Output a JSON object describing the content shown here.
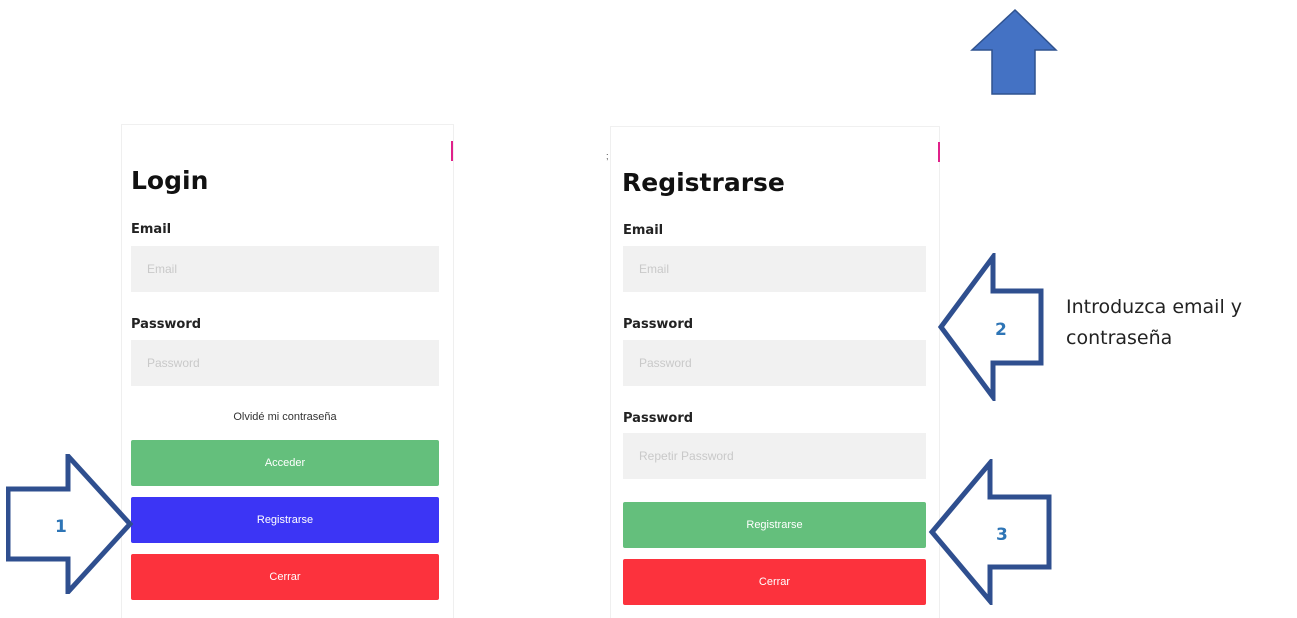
{
  "login": {
    "title": "Login",
    "email_label": "Email",
    "email_placeholder": "Email",
    "password_label": "Password",
    "password_placeholder": "Password",
    "forgot_link": "Olvidé mi contraseña",
    "access_button": "Acceder",
    "register_button": "Registrarse",
    "close_button": "Cerrar"
  },
  "register": {
    "title": "Registrarse",
    "email_label": "Email",
    "email_placeholder": "Email",
    "password_label": "Password",
    "password_placeholder": "Password",
    "repeat_label": "Password",
    "repeat_placeholder": "Repetir Password",
    "register_button": "Registrarse",
    "close_button": "Cerrar"
  },
  "annotations": {
    "arrow1_number": "1",
    "arrow2_number": "2",
    "arrow3_number": "3",
    "note_line1": "Introduzca email y",
    "note_line2": "contraseña"
  },
  "colors": {
    "access_button": "#64bf7c",
    "login_register_button": "#3c35f5",
    "close_button": "#fc323d",
    "arrow_fill_top": "#4472c4",
    "arrow_outline": "#2f4f8f",
    "arrow_number": "#2e75b6"
  }
}
